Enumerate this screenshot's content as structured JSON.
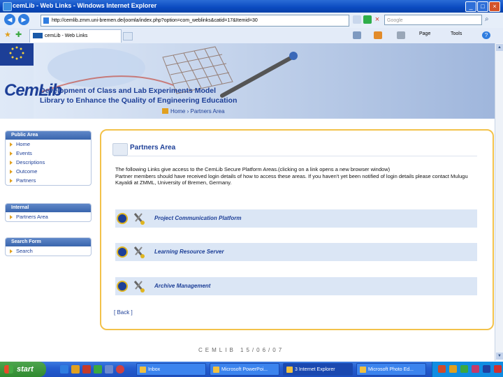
{
  "window": {
    "title": "cemLib - Web Links - Windows Internet Explorer"
  },
  "addressbar": {
    "url": "http://cemlib.zmm.uni-bremen.de/joomla/index.php?option=com_weblinks&catid=17&Itemid=30",
    "search_placeholder": "Google"
  },
  "tabbar": {
    "tab_label": "cemLib - Web Links",
    "page_menu": "Page",
    "tools_menu": "Tools"
  },
  "banner": {
    "logo_text": "CemLib",
    "project_line1": "Development of Class and Lab Experiments Model",
    "project_line2": "Library to Enhance the Quality of Engineering Education",
    "breadcrumb_home": "Home",
    "breadcrumb_sep": "›",
    "breadcrumb_current": "Partners Area"
  },
  "sidebar": {
    "public": {
      "title": "Public Area",
      "items": [
        "Home",
        "Events",
        "Descriptions",
        "Outcome",
        "Partners"
      ]
    },
    "internal": {
      "title": "Internal",
      "items": [
        "Partners Area"
      ]
    },
    "search": {
      "title": "Search Form",
      "items": [
        "Search"
      ]
    }
  },
  "main": {
    "title": "Partners Area",
    "intro": "The following Links give access to the CemLib Secure Platform Areas.(clicking on a link opens a new browser window)",
    "notice": "Partner members should have received login details of how to access these areas. If you haven't yet been notified of login details please contact Mulugu Kayaldi at ZMML, University of Bremen, Germany.",
    "links": [
      "Project Communication Platform",
      "Learning Resource Server",
      "Archive Management"
    ],
    "back_link": "[ Back ]"
  },
  "footer": {
    "text": "CEMLIB 15/06/07"
  },
  "taskbar": {
    "start_label": "start",
    "buttons": [
      "Inbox",
      "Microsoft PowerPoi...",
      "3 Internet Explorer",
      "Microsoft Photo Ed..."
    ]
  },
  "colors": {
    "accent": "#1d3f97",
    "panel_border": "#f3c24a",
    "link_row": "#dbe6f5"
  }
}
